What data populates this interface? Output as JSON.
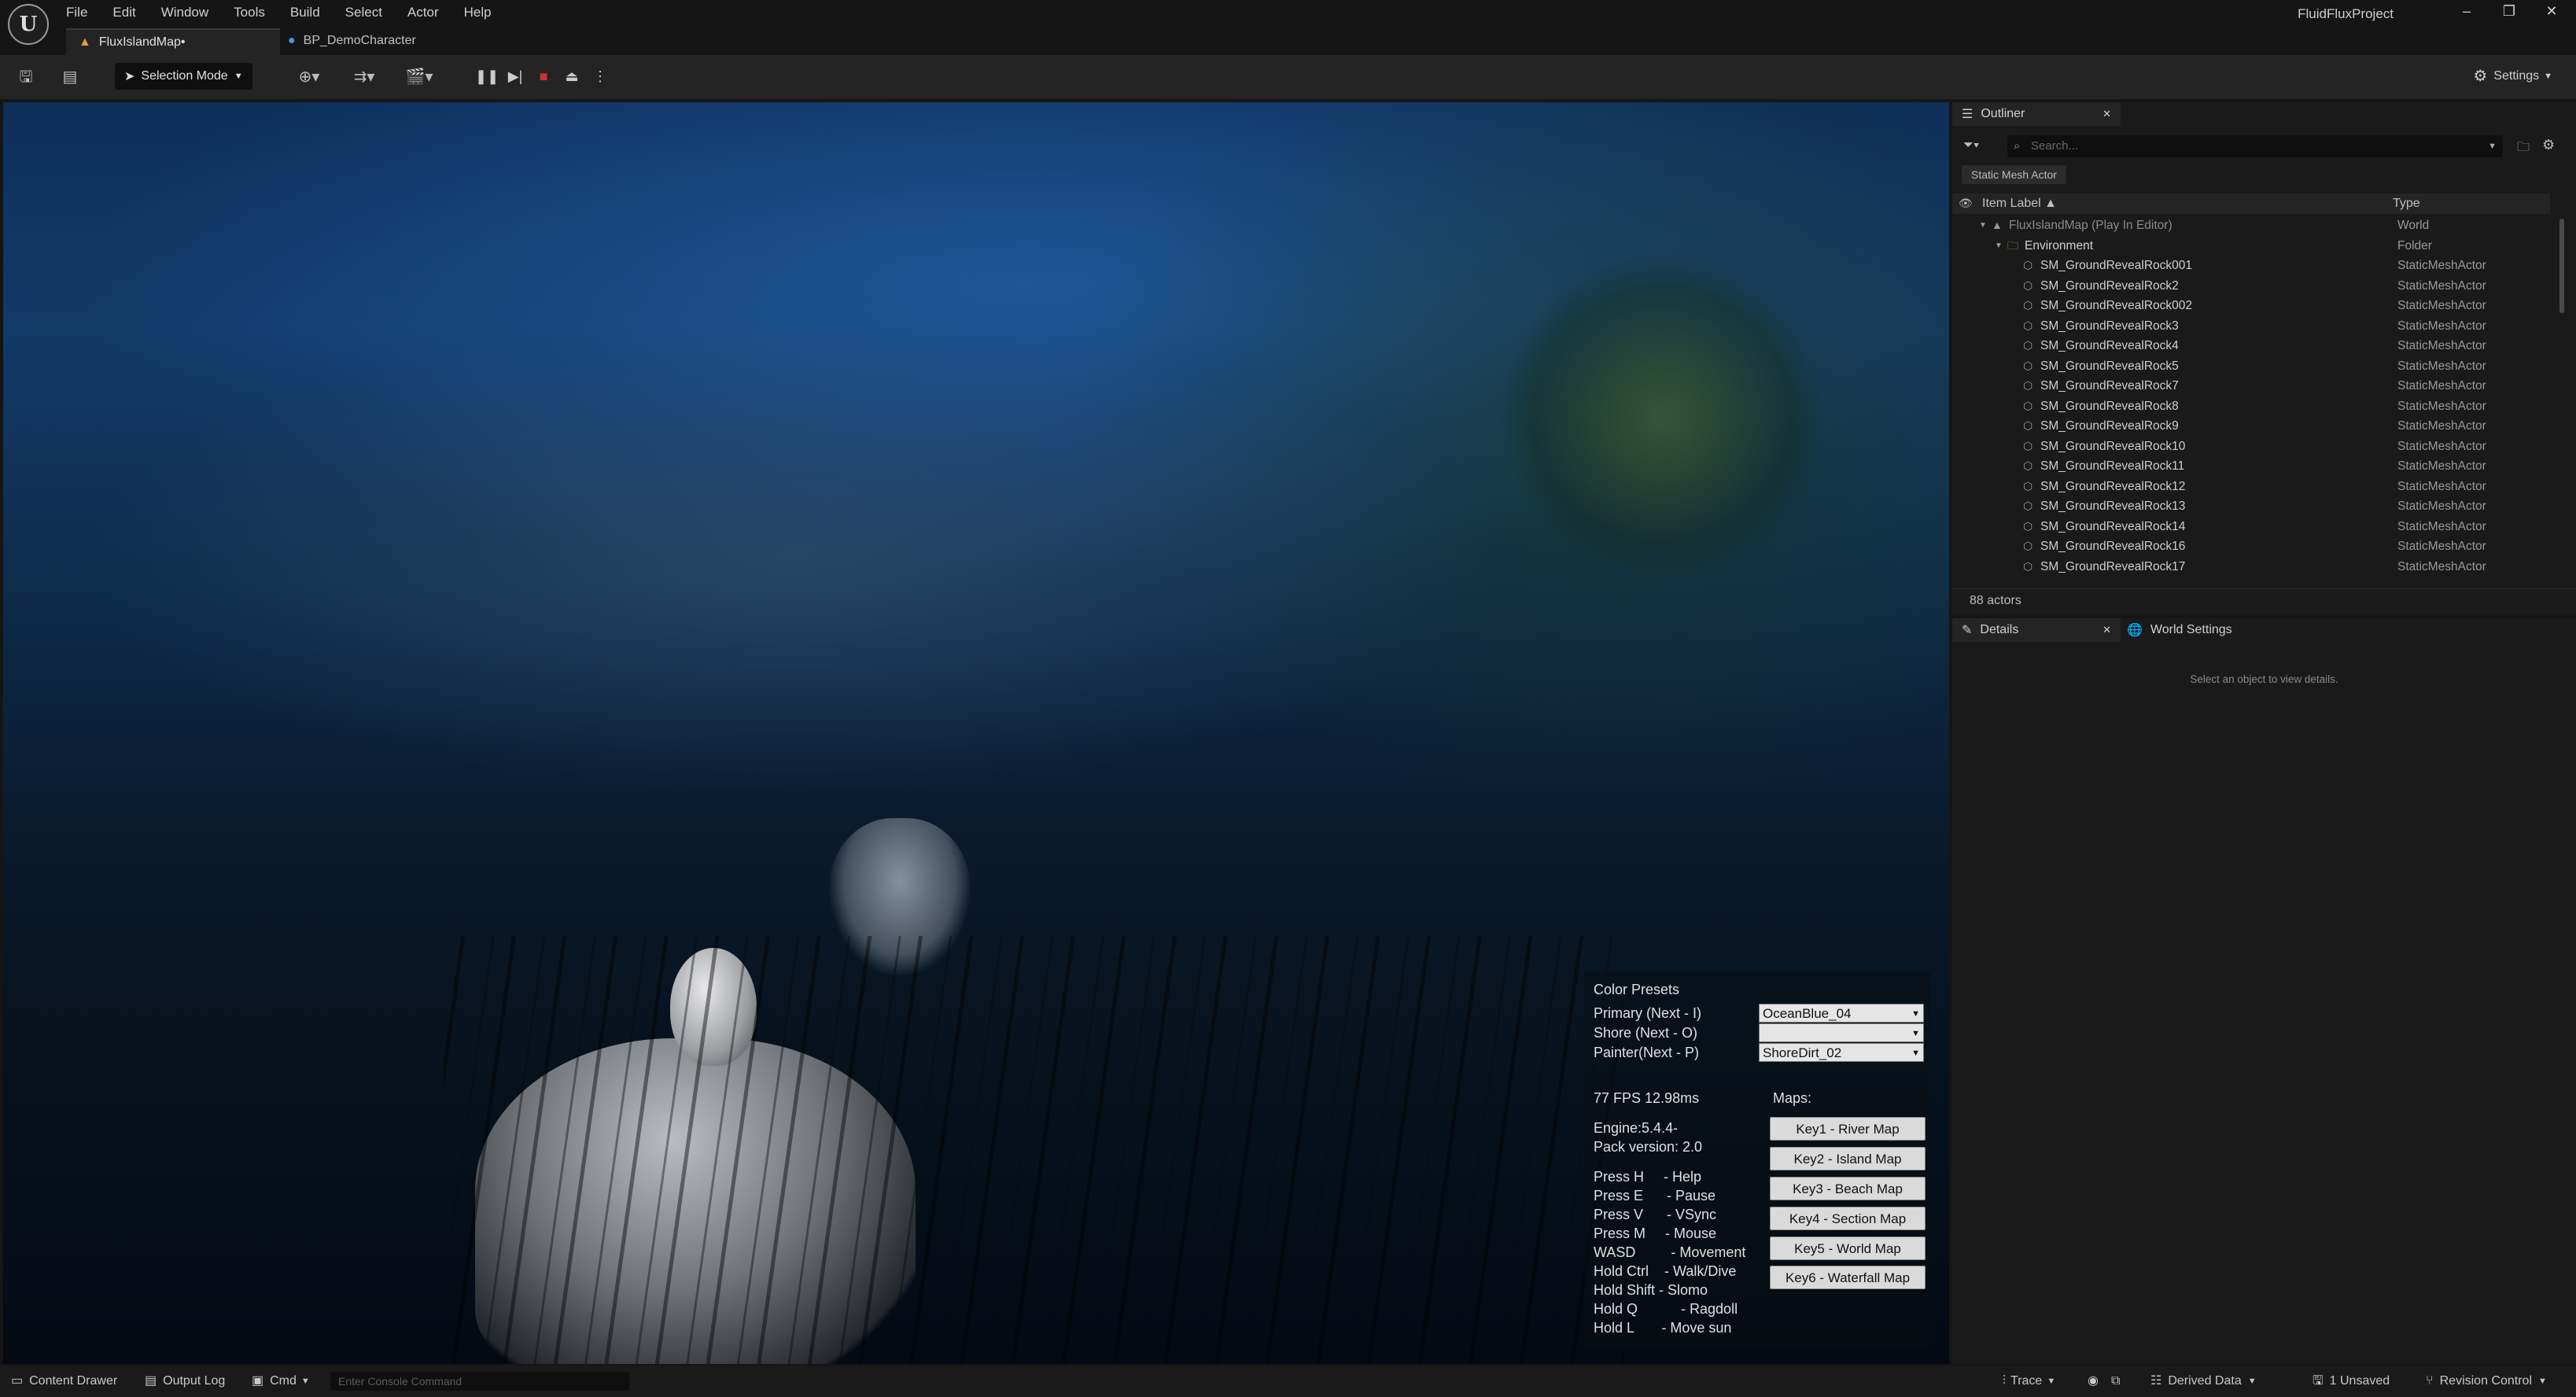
{
  "app": {
    "project_name": "FluidFluxProject",
    "logo": "unreal-engine-logo",
    "window_controls": [
      "minimize",
      "restore",
      "close"
    ]
  },
  "menu": [
    "File",
    "Edit",
    "Window",
    "Tools",
    "Build",
    "Select",
    "Actor",
    "Help"
  ],
  "tabs": [
    {
      "label": "FluxIslandMap•",
      "icon": "level-icon",
      "active": true
    },
    {
      "label": "BP_DemoCharacter",
      "icon": "blueprint-character-icon",
      "active": false
    }
  ],
  "toolbar": {
    "selection_mode": "Selection Mode",
    "settings": "Settings",
    "play_controls": [
      "pause",
      "step-forward",
      "stop",
      "eject"
    ]
  },
  "viewport": {
    "hud": {
      "color_presets_title": "Color Presets",
      "presets": [
        {
          "label": "Primary (Next - I)",
          "value": "OceanBlue_04"
        },
        {
          "label": "Shore (Next - O)",
          "value": ""
        },
        {
          "label": "Painter(Next - P)",
          "value": "ShoreDirt_02"
        }
      ],
      "fps": "77 FPS 12.98ms",
      "engine": "Engine:5.4.4-",
      "pack_version": "Pack version: 2.0",
      "help_lines": [
        "Press H     - Help",
        "Press E      - Pause",
        "Press V      - VSync",
        "Press M     - Mouse",
        "WASD         - Movement",
        "Hold Ctrl    - Walk/Dive",
        "Hold Shift - Slomo",
        "Hold Q           - Ragdoll",
        "Hold L       - Move sun"
      ],
      "maps_title": "Maps:",
      "map_buttons": [
        "Key1 - River Map",
        "Key2 - Island Map",
        "Key3 - Beach Map",
        "Key4 - Section Map",
        "Key5 - World Map",
        "Key6 - Waterfall Map"
      ]
    }
  },
  "outliner": {
    "tab_label": "Outliner",
    "search_placeholder": "Search...",
    "filter_chip": "Static Mesh Actor",
    "col_label": "Item Label ▲",
    "col_type": "Type",
    "rows": [
      {
        "label": "FluxIslandMap (Play In Editor)",
        "type": "World",
        "indent": 0,
        "kind": "world"
      },
      {
        "label": "Environment",
        "type": "Folder",
        "indent": 1,
        "kind": "folder"
      },
      {
        "label": "SM_GroundRevealRock001",
        "type": "StaticMeshActor",
        "indent": 2,
        "kind": "mesh"
      },
      {
        "label": "SM_GroundRevealRock2",
        "type": "StaticMeshActor",
        "indent": 2,
        "kind": "mesh"
      },
      {
        "label": "SM_GroundRevealRock002",
        "type": "StaticMeshActor",
        "indent": 2,
        "kind": "mesh"
      },
      {
        "label": "SM_GroundRevealRock3",
        "type": "StaticMeshActor",
        "indent": 2,
        "kind": "mesh"
      },
      {
        "label": "SM_GroundRevealRock4",
        "type": "StaticMeshActor",
        "indent": 2,
        "kind": "mesh"
      },
      {
        "label": "SM_GroundRevealRock5",
        "type": "StaticMeshActor",
        "indent": 2,
        "kind": "mesh"
      },
      {
        "label": "SM_GroundRevealRock7",
        "type": "StaticMeshActor",
        "indent": 2,
        "kind": "mesh"
      },
      {
        "label": "SM_GroundRevealRock8",
        "type": "StaticMeshActor",
        "indent": 2,
        "kind": "mesh"
      },
      {
        "label": "SM_GroundRevealRock9",
        "type": "StaticMeshActor",
        "indent": 2,
        "kind": "mesh"
      },
      {
        "label": "SM_GroundRevealRock10",
        "type": "StaticMeshActor",
        "indent": 2,
        "kind": "mesh"
      },
      {
        "label": "SM_GroundRevealRock11",
        "type": "StaticMeshActor",
        "indent": 2,
        "kind": "mesh"
      },
      {
        "label": "SM_GroundRevealRock12",
        "type": "StaticMeshActor",
        "indent": 2,
        "kind": "mesh"
      },
      {
        "label": "SM_GroundRevealRock13",
        "type": "StaticMeshActor",
        "indent": 2,
        "kind": "mesh"
      },
      {
        "label": "SM_GroundRevealRock14",
        "type": "StaticMeshActor",
        "indent": 2,
        "kind": "mesh"
      },
      {
        "label": "SM_GroundRevealRock16",
        "type": "StaticMeshActor",
        "indent": 2,
        "kind": "mesh"
      },
      {
        "label": "SM_GroundRevealRock17",
        "type": "StaticMeshActor",
        "indent": 2,
        "kind": "mesh"
      }
    ],
    "actor_count": "88 actors"
  },
  "details": {
    "tab_label": "Details",
    "world_settings_tab": "World Settings",
    "empty_message": "Select an object to view details."
  },
  "statusbar": {
    "content_drawer": "Content Drawer",
    "output_log": "Output Log",
    "cmd": "Cmd",
    "console_placeholder": "Enter Console Command",
    "trace": "Trace",
    "derived_data": "Derived Data",
    "unsaved": "1 Unsaved",
    "revision_control": "Revision Control"
  },
  "colors": {
    "accent_stop": "#d23030",
    "panel_bg": "#1a1a1a",
    "toolbar_bg": "#242424",
    "titlebar_bg": "#151515"
  }
}
